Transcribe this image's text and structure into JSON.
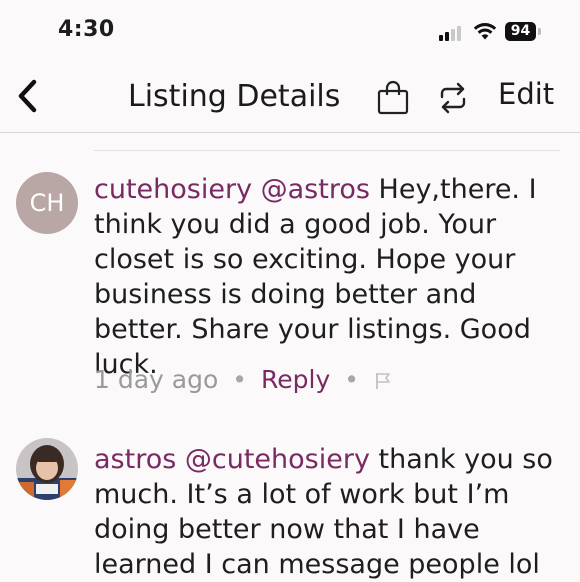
{
  "status_bar": {
    "time": "4:30",
    "battery": "94"
  },
  "nav": {
    "title": "Listing Details",
    "edit_label": "Edit",
    "icons": [
      "back-chevron-icon",
      "shopping-bag-icon",
      "share-repost-icon"
    ]
  },
  "comments": [
    {
      "avatar_initials": "CH",
      "username": "cutehosiery",
      "mention": "@astros",
      "text": "Hey,there. I think you did a good job. Your closet is so exciting. Hope your business is doing better and better. Share your listings. Good luck.",
      "timestamp": "1 day ago",
      "reply_label": "Reply",
      "flag_icon": "flag-icon"
    },
    {
      "avatar_icon": "profile-photo",
      "username": "astros",
      "mention": "@cutehosiery",
      "text": "thank you so much. It’s a lot of work but I’m doing better now that I have learned I can message people lol"
    }
  ],
  "colors": {
    "accent": "#7a2a63",
    "avatar_bg": "#b8a7a4",
    "background": "#fbf9fa"
  }
}
